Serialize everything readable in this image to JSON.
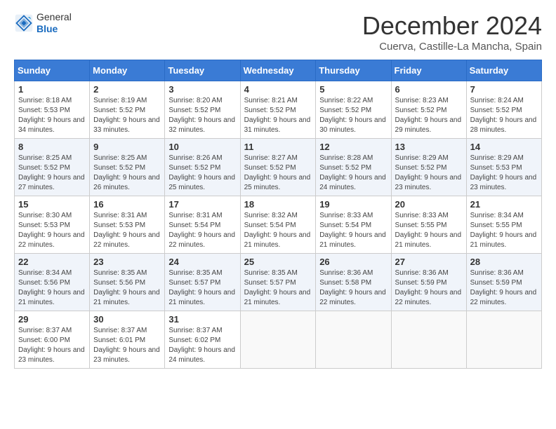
{
  "header": {
    "logo_general": "General",
    "logo_blue": "Blue",
    "month_title": "December 2024",
    "location": "Cuerva, Castille-La Mancha, Spain"
  },
  "calendar": {
    "weekdays": [
      "Sunday",
      "Monday",
      "Tuesday",
      "Wednesday",
      "Thursday",
      "Friday",
      "Saturday"
    ],
    "weeks": [
      [
        null,
        {
          "day": "2",
          "sunrise": "Sunrise: 8:19 AM",
          "sunset": "Sunset: 5:52 PM",
          "daylight": "Daylight: 9 hours and 33 minutes."
        },
        {
          "day": "3",
          "sunrise": "Sunrise: 8:20 AM",
          "sunset": "Sunset: 5:52 PM",
          "daylight": "Daylight: 9 hours and 32 minutes."
        },
        {
          "day": "4",
          "sunrise": "Sunrise: 8:21 AM",
          "sunset": "Sunset: 5:52 PM",
          "daylight": "Daylight: 9 hours and 31 minutes."
        },
        {
          "day": "5",
          "sunrise": "Sunrise: 8:22 AM",
          "sunset": "Sunset: 5:52 PM",
          "daylight": "Daylight: 9 hours and 30 minutes."
        },
        {
          "day": "6",
          "sunrise": "Sunrise: 8:23 AM",
          "sunset": "Sunset: 5:52 PM",
          "daylight": "Daylight: 9 hours and 29 minutes."
        },
        {
          "day": "7",
          "sunrise": "Sunrise: 8:24 AM",
          "sunset": "Sunset: 5:52 PM",
          "daylight": "Daylight: 9 hours and 28 minutes."
        }
      ],
      [
        {
          "day": "8",
          "sunrise": "Sunrise: 8:25 AM",
          "sunset": "Sunset: 5:52 PM",
          "daylight": "Daylight: 9 hours and 27 minutes."
        },
        {
          "day": "9",
          "sunrise": "Sunrise: 8:25 AM",
          "sunset": "Sunset: 5:52 PM",
          "daylight": "Daylight: 9 hours and 26 minutes."
        },
        {
          "day": "10",
          "sunrise": "Sunrise: 8:26 AM",
          "sunset": "Sunset: 5:52 PM",
          "daylight": "Daylight: 9 hours and 25 minutes."
        },
        {
          "day": "11",
          "sunrise": "Sunrise: 8:27 AM",
          "sunset": "Sunset: 5:52 PM",
          "daylight": "Daylight: 9 hours and 25 minutes."
        },
        {
          "day": "12",
          "sunrise": "Sunrise: 8:28 AM",
          "sunset": "Sunset: 5:52 PM",
          "daylight": "Daylight: 9 hours and 24 minutes."
        },
        {
          "day": "13",
          "sunrise": "Sunrise: 8:29 AM",
          "sunset": "Sunset: 5:52 PM",
          "daylight": "Daylight: 9 hours and 23 minutes."
        },
        {
          "day": "14",
          "sunrise": "Sunrise: 8:29 AM",
          "sunset": "Sunset: 5:53 PM",
          "daylight": "Daylight: 9 hours and 23 minutes."
        }
      ],
      [
        {
          "day": "15",
          "sunrise": "Sunrise: 8:30 AM",
          "sunset": "Sunset: 5:53 PM",
          "daylight": "Daylight: 9 hours and 22 minutes."
        },
        {
          "day": "16",
          "sunrise": "Sunrise: 8:31 AM",
          "sunset": "Sunset: 5:53 PM",
          "daylight": "Daylight: 9 hours and 22 minutes."
        },
        {
          "day": "17",
          "sunrise": "Sunrise: 8:31 AM",
          "sunset": "Sunset: 5:54 PM",
          "daylight": "Daylight: 9 hours and 22 minutes."
        },
        {
          "day": "18",
          "sunrise": "Sunrise: 8:32 AM",
          "sunset": "Sunset: 5:54 PM",
          "daylight": "Daylight: 9 hours and 21 minutes."
        },
        {
          "day": "19",
          "sunrise": "Sunrise: 8:33 AM",
          "sunset": "Sunset: 5:54 PM",
          "daylight": "Daylight: 9 hours and 21 minutes."
        },
        {
          "day": "20",
          "sunrise": "Sunrise: 8:33 AM",
          "sunset": "Sunset: 5:55 PM",
          "daylight": "Daylight: 9 hours and 21 minutes."
        },
        {
          "day": "21",
          "sunrise": "Sunrise: 8:34 AM",
          "sunset": "Sunset: 5:55 PM",
          "daylight": "Daylight: 9 hours and 21 minutes."
        }
      ],
      [
        {
          "day": "22",
          "sunrise": "Sunrise: 8:34 AM",
          "sunset": "Sunset: 5:56 PM",
          "daylight": "Daylight: 9 hours and 21 minutes."
        },
        {
          "day": "23",
          "sunrise": "Sunrise: 8:35 AM",
          "sunset": "Sunset: 5:56 PM",
          "daylight": "Daylight: 9 hours and 21 minutes."
        },
        {
          "day": "24",
          "sunrise": "Sunrise: 8:35 AM",
          "sunset": "Sunset: 5:57 PM",
          "daylight": "Daylight: 9 hours and 21 minutes."
        },
        {
          "day": "25",
          "sunrise": "Sunrise: 8:35 AM",
          "sunset": "Sunset: 5:57 PM",
          "daylight": "Daylight: 9 hours and 21 minutes."
        },
        {
          "day": "26",
          "sunrise": "Sunrise: 8:36 AM",
          "sunset": "Sunset: 5:58 PM",
          "daylight": "Daylight: 9 hours and 22 minutes."
        },
        {
          "day": "27",
          "sunrise": "Sunrise: 8:36 AM",
          "sunset": "Sunset: 5:59 PM",
          "daylight": "Daylight: 9 hours and 22 minutes."
        },
        {
          "day": "28",
          "sunrise": "Sunrise: 8:36 AM",
          "sunset": "Sunset: 5:59 PM",
          "daylight": "Daylight: 9 hours and 22 minutes."
        }
      ],
      [
        {
          "day": "29",
          "sunrise": "Sunrise: 8:37 AM",
          "sunset": "Sunset: 6:00 PM",
          "daylight": "Daylight: 9 hours and 23 minutes."
        },
        {
          "day": "30",
          "sunrise": "Sunrise: 8:37 AM",
          "sunset": "Sunset: 6:01 PM",
          "daylight": "Daylight: 9 hours and 23 minutes."
        },
        {
          "day": "31",
          "sunrise": "Sunrise: 8:37 AM",
          "sunset": "Sunset: 6:02 PM",
          "daylight": "Daylight: 9 hours and 24 minutes."
        },
        null,
        null,
        null,
        null
      ]
    ],
    "day1": {
      "day": "1",
      "sunrise": "Sunrise: 8:18 AM",
      "sunset": "Sunset: 5:53 PM",
      "daylight": "Daylight: 9 hours and 34 minutes."
    }
  }
}
